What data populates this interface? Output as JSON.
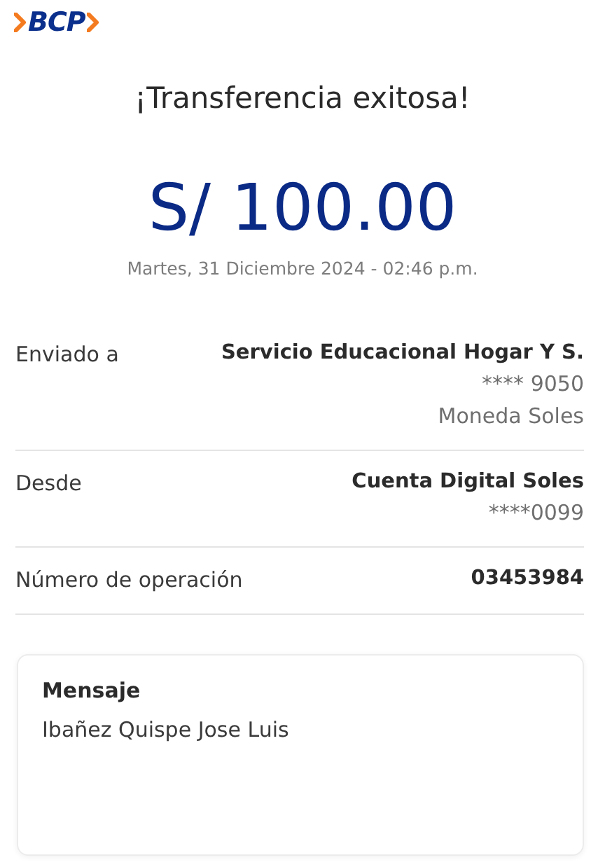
{
  "logo": {
    "text": "BCP"
  },
  "title": "¡Transferencia exitosa!",
  "amount": "S/ 100.00",
  "datetime": "Martes, 31 Diciembre 2024 - 02:46 p.m.",
  "details": [
    {
      "label": "Enviado a",
      "value": "Servicio Educacional Hogar Y S.",
      "extra": [
        "**** 9050",
        "Moneda Soles"
      ]
    },
    {
      "label": "Desde",
      "value": "Cuenta Digital Soles",
      "extra": [
        "****0099"
      ]
    },
    {
      "label": "Número de operación",
      "value": "03453984"
    }
  ],
  "message": {
    "title": "Mensaje",
    "text": "Ibañez Quispe Jose Luis"
  }
}
